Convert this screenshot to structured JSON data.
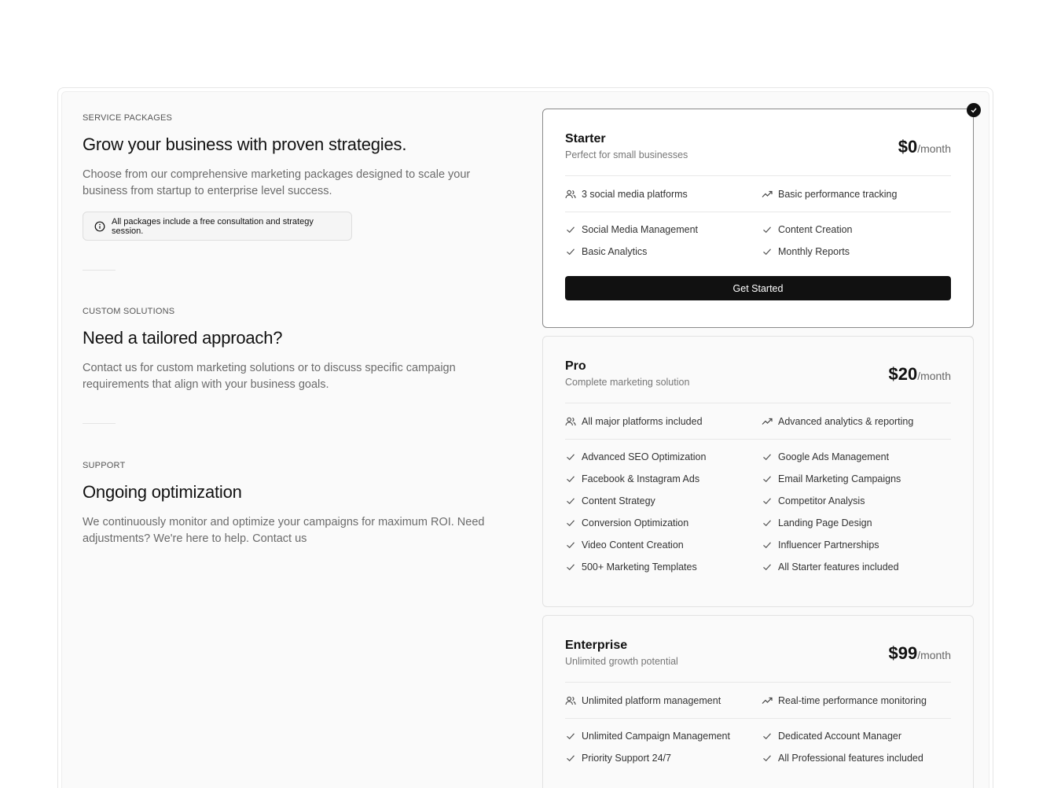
{
  "left": {
    "packages": {
      "eyebrow": "SERVICE PACKAGES",
      "title": "Grow your business with proven strategies.",
      "body": "Choose from our comprehensive marketing packages designed to scale your business from startup to enterprise level success.",
      "note": "All packages include a free consultation and strategy session."
    },
    "custom": {
      "eyebrow": "CUSTOM SOLUTIONS",
      "title": "Need a tailored approach?",
      "body": "Contact us for custom marketing solutions or to discuss specific campaign requirements that align with your business goals."
    },
    "support": {
      "eyebrow": "SUPPORT",
      "title": "Ongoing optimization",
      "body": "We continuously monitor and optimize your campaigns for maximum ROI. Need adjustments? We're here to help. Contact us"
    }
  },
  "plans": {
    "starter": {
      "name": "Starter",
      "tagline": "Perfect for small businesses",
      "price": "$0",
      "per": "/month",
      "platforms": "3 social media platforms",
      "tracking": "Basic performance tracking",
      "features": [
        "Social Media Management",
        "Content Creation",
        "Basic Analytics",
        "Monthly Reports"
      ],
      "cta": "Get Started",
      "selected": true
    },
    "pro": {
      "name": "Pro",
      "tagline": "Complete marketing solution",
      "price": "$20",
      "per": "/month",
      "platforms": "All major platforms included",
      "tracking": "Advanced analytics & reporting",
      "features": [
        "Advanced SEO Optimization",
        "Google Ads Management",
        "Facebook & Instagram Ads",
        "Email Marketing Campaigns",
        "Content Strategy",
        "Competitor Analysis",
        "Conversion Optimization",
        "Landing Page Design",
        "Video Content Creation",
        "Influencer Partnerships",
        "500+ Marketing Templates",
        "All Starter features included"
      ]
    },
    "enterprise": {
      "name": "Enterprise",
      "tagline": "Unlimited growth potential",
      "price": "$99",
      "per": "/month",
      "platforms": "Unlimited platform management",
      "tracking": "Real-time performance monitoring",
      "features": [
        "Unlimited Campaign Management",
        "Dedicated Account Manager",
        "Priority Support 24/7",
        "All Professional features included"
      ]
    }
  },
  "icons": {
    "info": "info-circle-icon",
    "users": "users-icon",
    "trend": "trending-up-icon",
    "check": "check-icon",
    "selected": "check-circle-icon"
  },
  "colors": {
    "primary": "#111111",
    "muted": "#6b6b6b",
    "border": "#e2e2e2"
  }
}
